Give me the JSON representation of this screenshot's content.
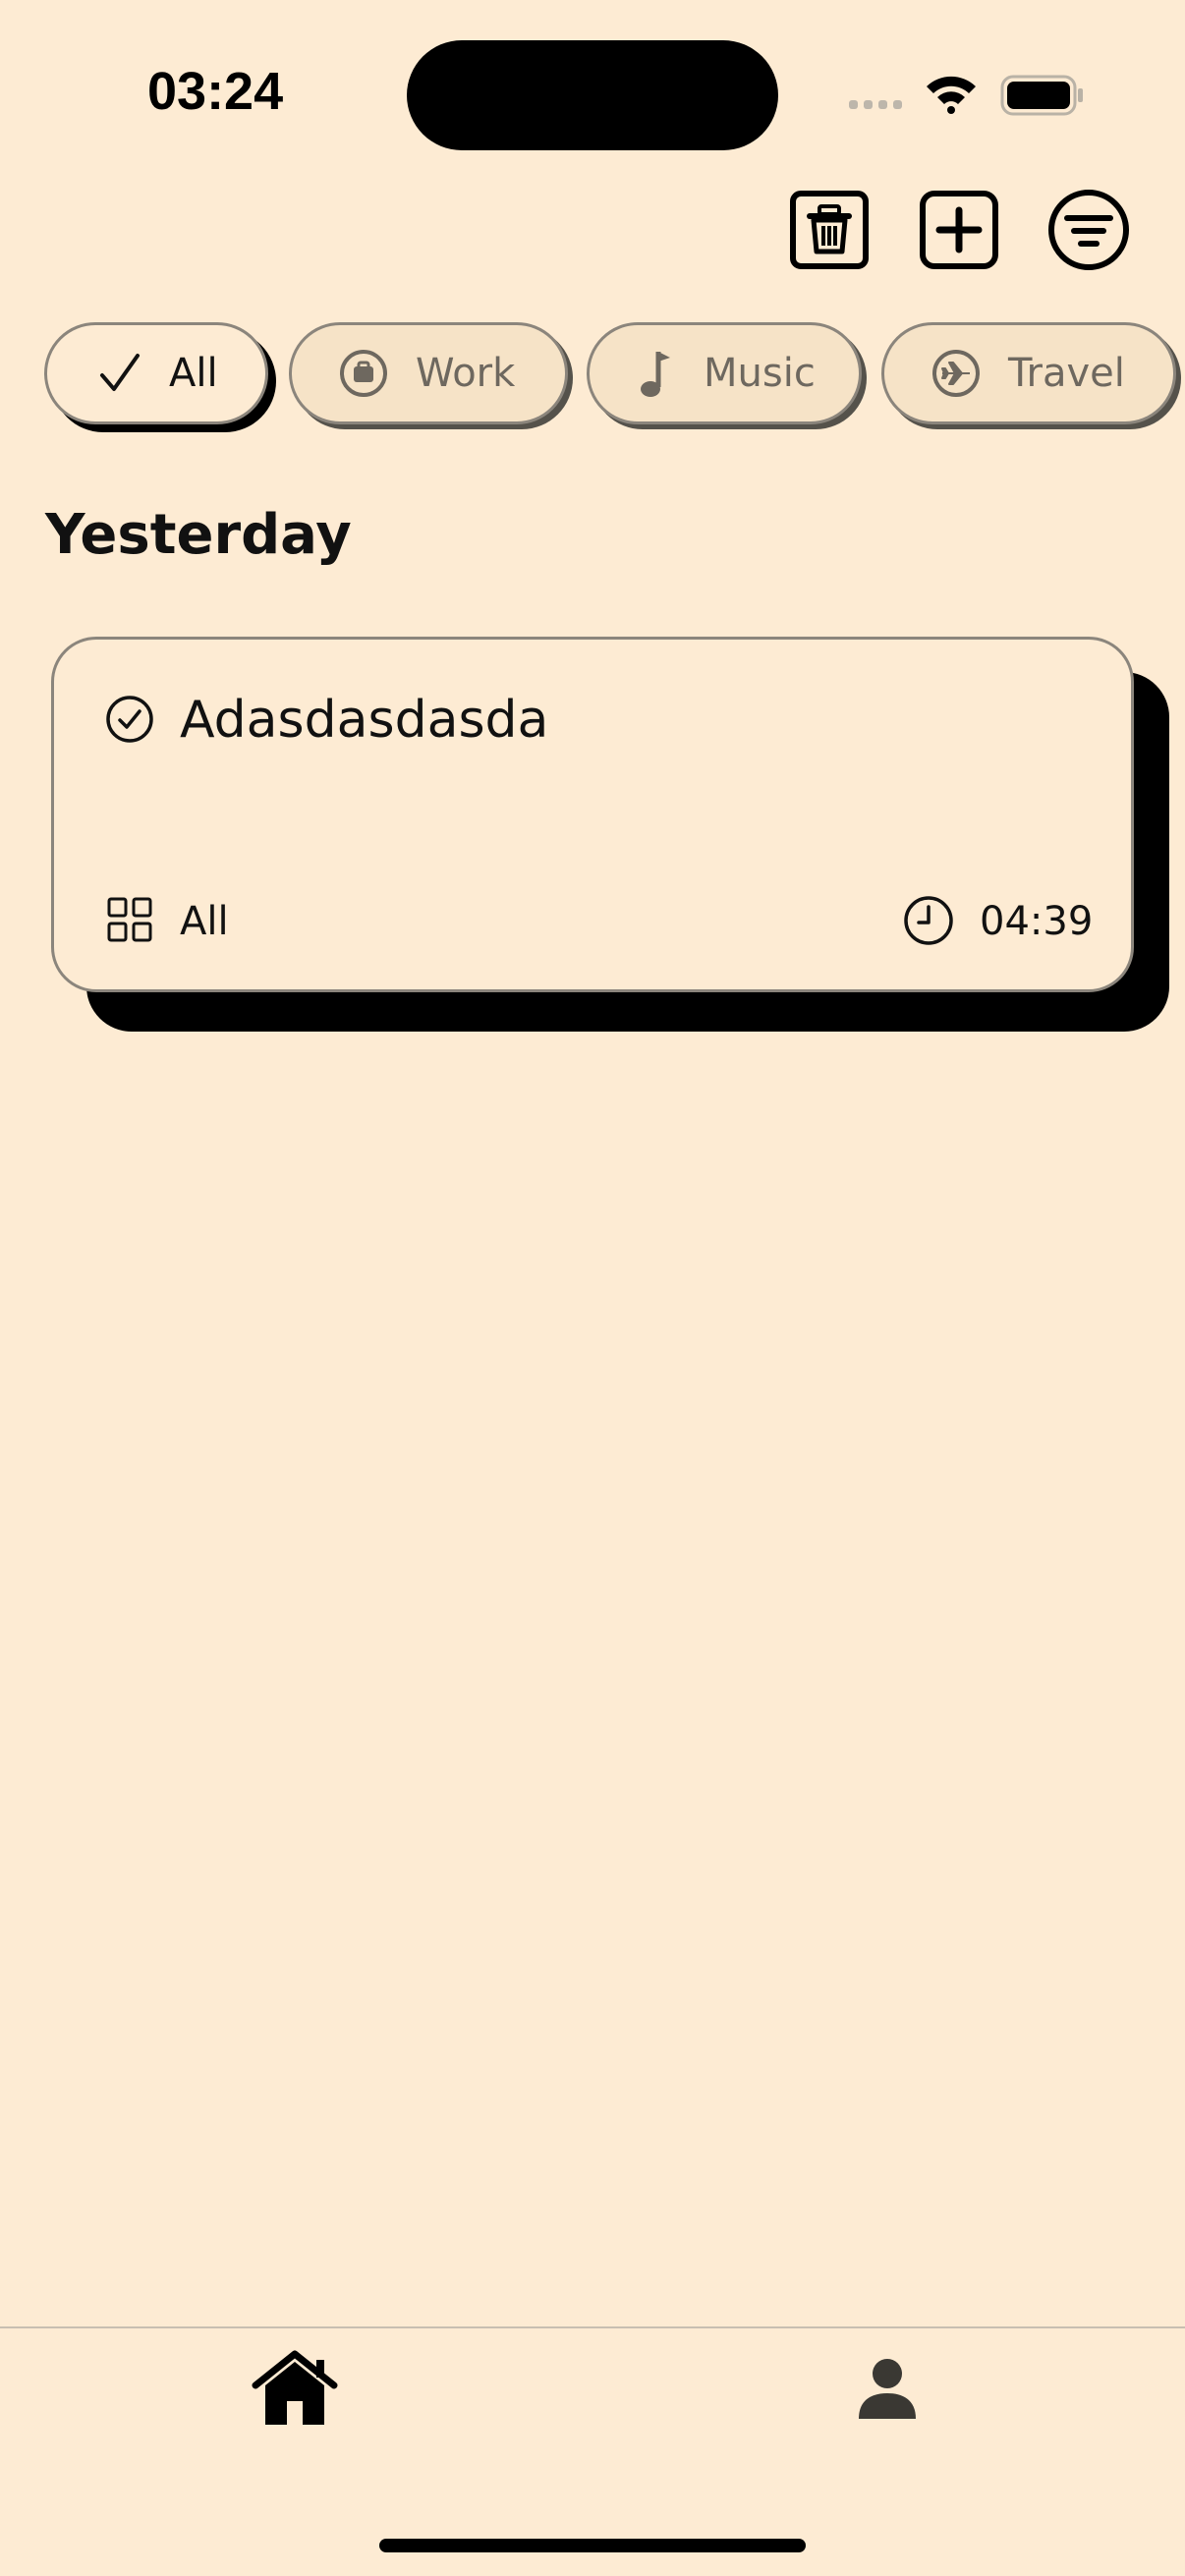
{
  "status_bar": {
    "time": "03:24"
  },
  "toolbar": {
    "delete_icon": "trash-icon",
    "add_icon": "plus-square-icon",
    "filter_icon": "filter-lines-icon"
  },
  "categories": [
    {
      "label": "All",
      "icon": "checkmark-icon",
      "selected": true
    },
    {
      "label": "Work",
      "icon": "briefcase-icon",
      "selected": false
    },
    {
      "label": "Music",
      "icon": "music-note-icon",
      "selected": false
    },
    {
      "label": "Travel",
      "icon": "airplane-icon",
      "selected": false
    }
  ],
  "section": {
    "title": "Yesterday"
  },
  "tasks": [
    {
      "title": "Adasdasdasda",
      "category": "All",
      "time": "04:39"
    }
  ],
  "tabbar": {
    "items": [
      {
        "icon": "home-icon",
        "selected": true
      },
      {
        "icon": "person-icon",
        "selected": false
      }
    ]
  },
  "colors": {
    "background": "#FDEBD3",
    "chip_inactive": "#F6E3C7",
    "border": "#8b857c",
    "shadow": "#000000"
  }
}
